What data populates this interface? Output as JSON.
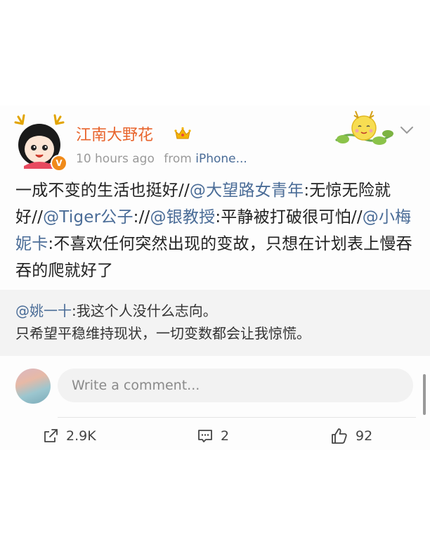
{
  "post": {
    "username": "江南大野花",
    "time": "10 hours ago",
    "from_label": "from",
    "source": "iPhone...",
    "content": [
      {
        "t": "一成不变的生活也挺好//",
        "m": false
      },
      {
        "t": "@大望路女青年",
        "m": true
      },
      {
        "t": ":无惊无险就好//",
        "m": false
      },
      {
        "t": "@Tiger公子",
        "m": true
      },
      {
        "t": "://",
        "m": false
      },
      {
        "t": "@银教授",
        "m": true
      },
      {
        "t": ":平静被打破很可怕//",
        "m": false
      },
      {
        "t": "@小梅妮卡",
        "m": true
      },
      {
        "t": ":不喜欢任何突然出现的变故，只想在计划表上慢吞吞的爬就好了",
        "m": false
      }
    ]
  },
  "repost": {
    "author": "@姚一十",
    "line1": ":我这个人没什么志向。",
    "line2": "只希望平稳维持现状，一切变数都会让我惊慌。"
  },
  "comment": {
    "placeholder": "Write a comment..."
  },
  "actions": {
    "share_count": "2.9K",
    "comment_count": "2",
    "like_count": "92"
  },
  "colors": {
    "username": "#e8632b",
    "mention": "#4a6c97",
    "verified": "#f08a1a"
  },
  "icons": [
    "avatar-image",
    "verified-icon",
    "crown-icon",
    "sticker-image",
    "chevron-down-icon",
    "share-icon",
    "comment-icon",
    "like-icon"
  ]
}
